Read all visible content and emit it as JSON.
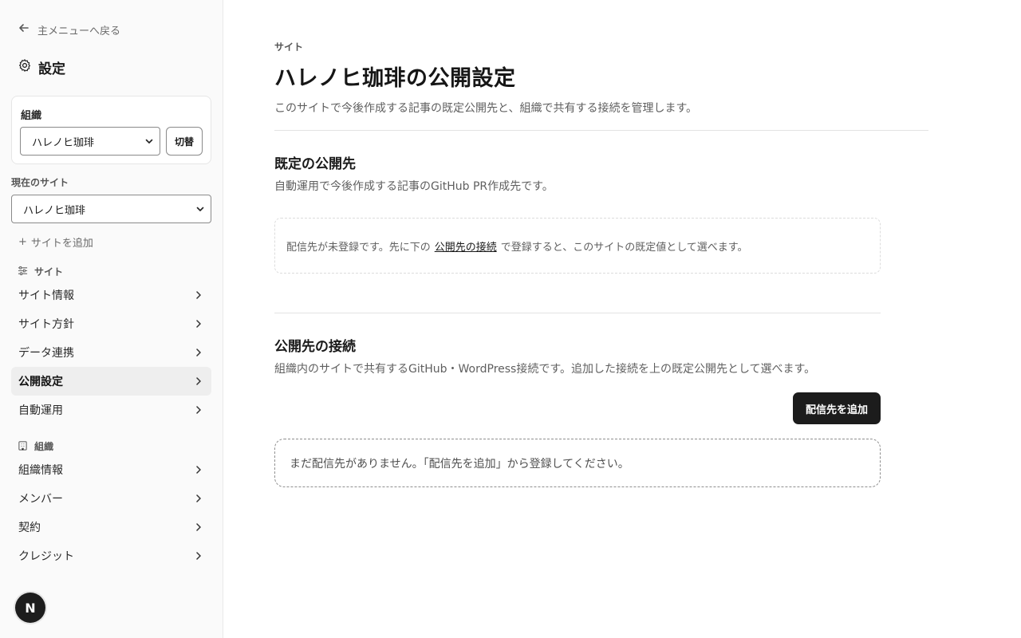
{
  "sidebar": {
    "back_label": "主メニューへ戻る",
    "title": "設定",
    "org": {
      "label": "組織",
      "selected": "ハレノヒ珈琲",
      "switch_label": "切替"
    },
    "current_site": {
      "label": "現在のサイト",
      "selected": "ハレノヒ珈琲"
    },
    "add_site_label": "サイトを追加",
    "site_section": {
      "label": "サイト",
      "items": [
        {
          "label": "サイト情報"
        },
        {
          "label": "サイト方針"
        },
        {
          "label": "データ連携"
        },
        {
          "label": "公開設定"
        },
        {
          "label": "自動運用"
        }
      ]
    },
    "org_section": {
      "label": "組織",
      "items": [
        {
          "label": "組織情報"
        },
        {
          "label": "メンバー"
        },
        {
          "label": "契約"
        },
        {
          "label": "クレジット"
        }
      ]
    },
    "avatar_initial": "N"
  },
  "main": {
    "eyebrow": "サイト",
    "title": "ハレノヒ珈琲の公開設定",
    "description": "このサイトで今後作成する記事の既定公開先と、組織で共有する接続を管理します。",
    "default_target": {
      "heading": "既定の公開先",
      "description": "自動運用で今後作成する記事のGitHub PR作成先です。",
      "notice_before": "配信先が未登録です。先に下の",
      "notice_link": "公開先の接続",
      "notice_after": "で登録すると、このサイトの既定値として選べます。"
    },
    "connections": {
      "heading": "公開先の接続",
      "description": "組織内のサイトで共有するGitHub・WordPress接続です。追加した接続を上の既定公開先として選べます。",
      "add_button": "配信先を追加",
      "empty_text": "まだ配信先がありません。「配信先を追加」から登録してください。"
    }
  },
  "icons": {
    "back": "arrow-left-icon",
    "settings": "gear-icon",
    "site": "sliders-icon",
    "org": "building-icon",
    "chevron": "chevron-right-icon",
    "caret": "chevron-down-icon"
  }
}
